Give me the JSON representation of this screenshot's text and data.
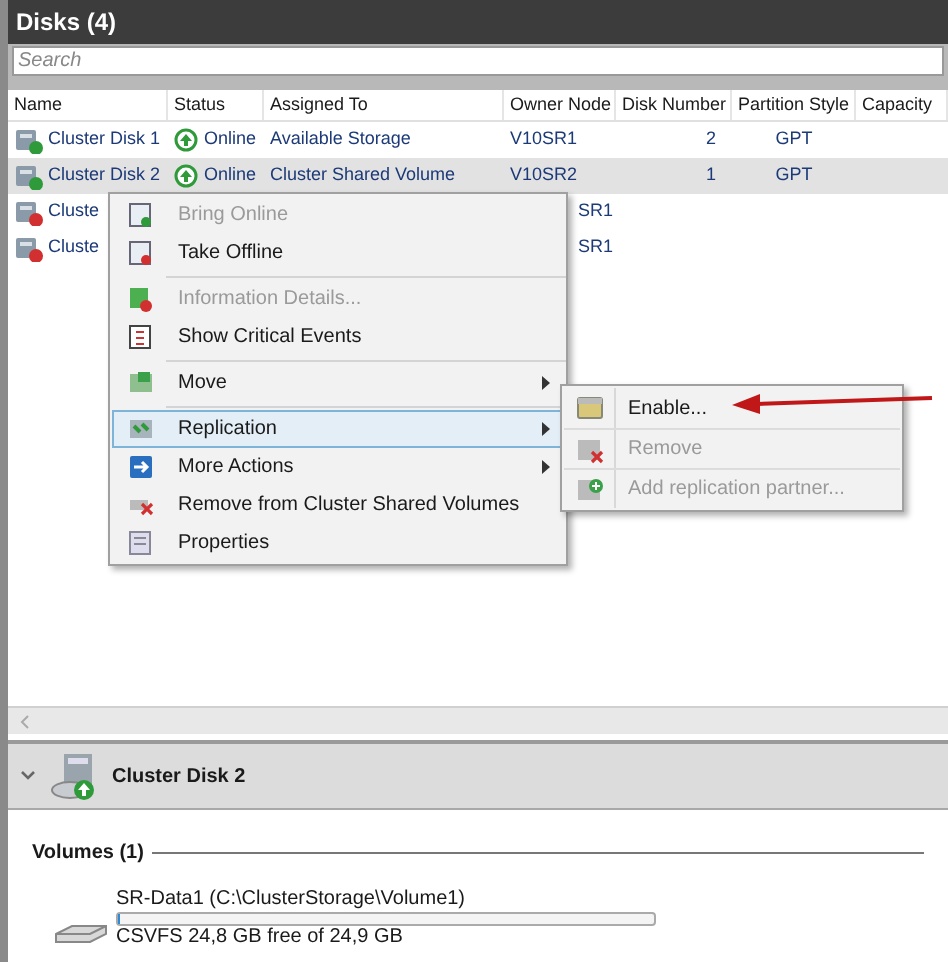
{
  "panel": {
    "title": "Disks (4)"
  },
  "search": {
    "placeholder": "Search"
  },
  "table": {
    "columns": [
      "Name",
      "Status",
      "Assigned To",
      "Owner Node",
      "Disk Number",
      "Partition Style",
      "Capacity"
    ],
    "rows": [
      {
        "online": true,
        "selected": false,
        "cells": [
          "Cluster Disk 1",
          "Online",
          "Available Storage",
          "V10SR1",
          "2",
          "GPT"
        ]
      },
      {
        "online": true,
        "selected": true,
        "cells": [
          "Cluster Disk 2",
          "Online",
          "Cluster Shared Volume",
          "V10SR2",
          "1",
          "GPT"
        ]
      },
      {
        "online": false,
        "selected": false,
        "cells": [
          "Cluste",
          "",
          "",
          "SR1",
          "",
          ""
        ]
      },
      {
        "online": false,
        "selected": false,
        "cells": [
          "Cluste",
          "",
          "",
          "SR1",
          "",
          ""
        ]
      }
    ]
  },
  "context_menu": {
    "items": [
      {
        "kind": "item",
        "label": "Bring Online",
        "disabled": true,
        "selected": false,
        "submenu": false
      },
      {
        "kind": "item",
        "label": "Take Offline",
        "disabled": false,
        "selected": false,
        "submenu": false
      },
      {
        "kind": "separator"
      },
      {
        "kind": "item",
        "label": "Information Details...",
        "disabled": true,
        "selected": false,
        "submenu": false
      },
      {
        "kind": "item",
        "label": "Show Critical Events",
        "disabled": false,
        "selected": false,
        "submenu": false
      },
      {
        "kind": "separator"
      },
      {
        "kind": "item",
        "label": "Move",
        "disabled": false,
        "selected": false,
        "submenu": true
      },
      {
        "kind": "separator"
      },
      {
        "kind": "item",
        "label": "Replication",
        "disabled": false,
        "selected": true,
        "submenu": true
      },
      {
        "kind": "item",
        "label": "More Actions",
        "disabled": false,
        "selected": false,
        "submenu": true
      },
      {
        "kind": "item",
        "label": "Remove from Cluster Shared Volumes",
        "disabled": false,
        "selected": false,
        "submenu": false
      },
      {
        "kind": "item",
        "label": "Properties",
        "disabled": false,
        "selected": false,
        "submenu": false
      }
    ]
  },
  "submenu": {
    "items": [
      {
        "label": "Enable...",
        "disabled": false
      },
      {
        "label": "Remove",
        "disabled": true
      },
      {
        "label": "Add replication partner...",
        "disabled": true
      }
    ]
  },
  "details": {
    "title": "Cluster Disk 2",
    "online": true,
    "section": "Volumes (1)",
    "volume": {
      "name": "SR-Data1 (C:\\ClusterStorage\\Volume1)",
      "level": 0,
      "summary": "CSVFS 24,8 GB free of 24,9 GB"
    }
  }
}
